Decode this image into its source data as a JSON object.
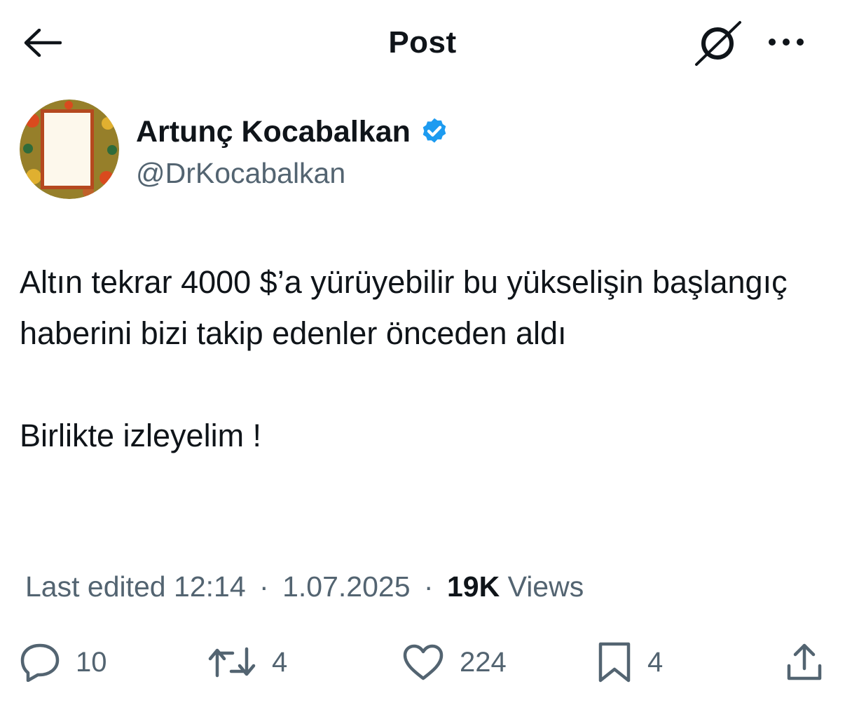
{
  "header": {
    "title": "Post",
    "back_icon": "arrow-left-icon",
    "grok_icon": "grok-icon",
    "more_icon": "more-horizontal-icon"
  },
  "author": {
    "display_name": "Artunç Kocabalkan",
    "handle": "@DrKocabalkan",
    "verified": true,
    "verified_color": "#1d9bf0"
  },
  "tweet": {
    "paragraphs": [
      "Altın tekrar 4000 $’a yürüyebilir bu yükselişin başlangıç haberini bizi takip edenler önceden aldı",
      "Birlikte izleyelim !"
    ]
  },
  "meta": {
    "edited_label": "Last edited",
    "time": "12:14",
    "date": "1.07.2025",
    "views_count": "19K",
    "views_label": "Views"
  },
  "actions": {
    "replies": "10",
    "reposts": "4",
    "likes": "224",
    "bookmarks": "4"
  },
  "colors": {
    "text": "#0f1419",
    "secondary": "#536471",
    "accent": "#1d9bf0"
  }
}
